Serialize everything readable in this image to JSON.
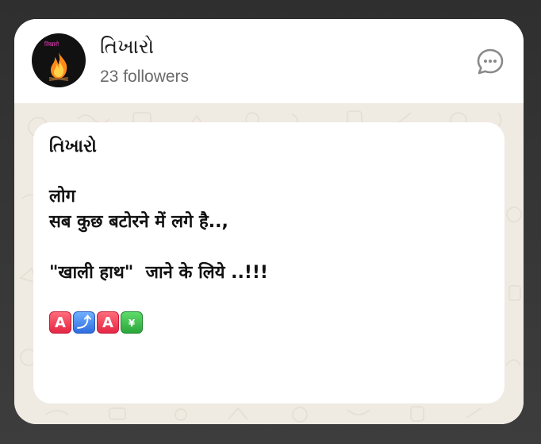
{
  "channel": {
    "name": "તિખારો",
    "followers": "23 followers",
    "avatar_tag": "तिखारो"
  },
  "post": {
    "title": "તિખારો",
    "lines": [
      "लोग",
      "सब कुछ बटोरने में लगे है..,",
      "\"खाली हाथ\"  जाने के लिये ..!!!"
    ],
    "emoji_signature": [
      "A",
      "⤴",
      "A",
      "¥"
    ]
  },
  "icons": {
    "chat": "chat-bubble-dots-icon",
    "avatar": "bonfire-icon"
  },
  "colors": {
    "chat_background": "#efeae2",
    "emoji_red": "#e52645",
    "emoji_blue": "#2f6ce0",
    "emoji_green": "#2ba63a"
  }
}
